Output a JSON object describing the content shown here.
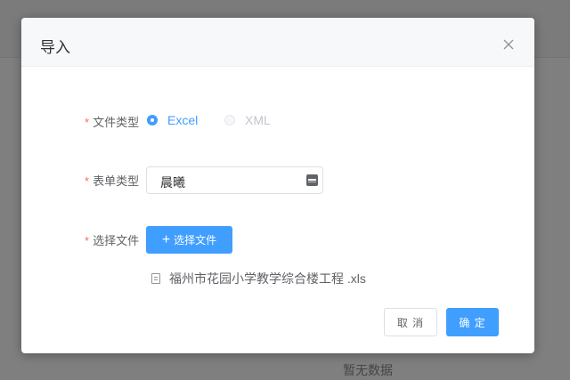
{
  "background": {
    "empty_text": "暂无数据"
  },
  "dialog": {
    "title": "导入",
    "close_icon": "close-icon"
  },
  "form": {
    "required_mark": "*",
    "file_type": {
      "label": "文件类型",
      "options": [
        {
          "label": "Excel",
          "checked": true,
          "disabled": false
        },
        {
          "label": "XML",
          "checked": false,
          "disabled": true
        }
      ]
    },
    "form_type": {
      "label": "表单类型",
      "value": "晨曦",
      "icon": "select-keyboard-icon"
    },
    "select_file": {
      "label": "选择文件",
      "button_label": "选择文件",
      "button_icon": "+"
    },
    "file_list": [
      {
        "name": "福州市花园小学教学综合楼工程 .xls",
        "icon": "document-icon"
      }
    ]
  },
  "footer": {
    "cancel_label": "取 消",
    "ok_label": "确 定"
  },
  "colors": {
    "primary": "#409eff",
    "required": "#f56c6c",
    "text": "#606266",
    "overlay": "#7f7f7f"
  }
}
